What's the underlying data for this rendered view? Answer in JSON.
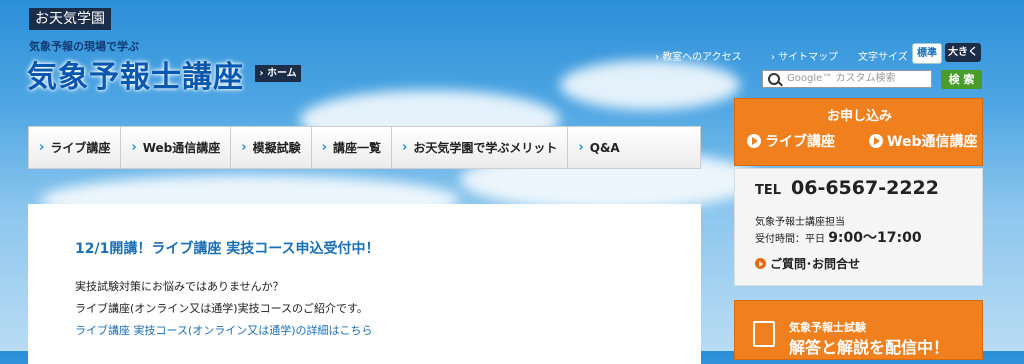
{
  "header": {
    "site_badge": "お天気学園",
    "tagline": "気象予報の現場で学ぶ",
    "title": "気象予報士講座",
    "home_button": "ホーム"
  },
  "utility": {
    "access": "教室へのアクセス",
    "sitemap": "サイトマップ",
    "font_size_label": "文字サイズ",
    "font_standard": "標準",
    "font_large": "大きく"
  },
  "search": {
    "placeholder": "Google™ カスタム検索",
    "button": "検 索"
  },
  "nav": {
    "items": [
      "ライブ講座",
      "Web通信講座",
      "模擬試験",
      "講座一覧",
      "お天気学園で学ぶメリット",
      "Q&A"
    ]
  },
  "main": {
    "headline": "12/1開講！ライブ講座 実技コース申込受付中！",
    "line1": "実技試験対策にお悩みではありませんか？",
    "line2": "ライブ講座(オンライン又は通学)実技コースのご紹介です。",
    "link": "ライブ講座 実技コース(オンライン又は通学)の詳細はこちら"
  },
  "apply": {
    "title": "お申し込み",
    "live": "ライブ講座",
    "web": "Web通信講座"
  },
  "contact": {
    "tel_label": "TEL",
    "tel": "06-6567-2222",
    "dept": "気象予報士講座担当",
    "hours_label": "受付時間：平日",
    "hours": "9:00〜17:00",
    "inquiry": "ご質問･お問合せ"
  },
  "exam_banner": {
    "sub": "気象予報士試験",
    "main": "解答と解説を配信中！"
  },
  "colors": {
    "accent_orange": "#f07f1e",
    "link_blue": "#1a6fb5",
    "dark_navy": "#1c2d4a",
    "search_green": "#4a9c2a"
  }
}
